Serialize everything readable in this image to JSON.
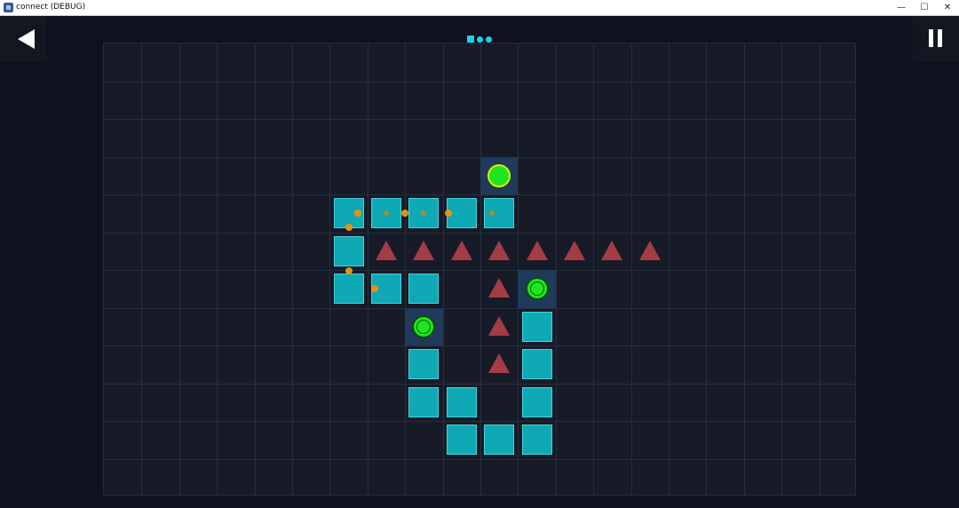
{
  "window": {
    "title": "connect (DEBUG)",
    "minimize_glyph": "—",
    "maximize_glyph": "☐",
    "close_glyph": "✕"
  },
  "toolbar": {
    "back_icon": "back-arrow-icon",
    "pause_icon": "pause-icon"
  },
  "level_progress": {
    "indicators": [
      "square",
      "circle",
      "circle"
    ],
    "color": "#1ccfe6"
  },
  "board": {
    "cols": 20,
    "rows": 12,
    "colors": {
      "background": "#161b27",
      "tile": "#0fa8b5",
      "hazard": "#a43c46",
      "target": "#1ee61e",
      "orb": "#e8920f"
    },
    "tiles": [
      [
        6,
        4
      ],
      [
        7,
        4
      ],
      [
        8,
        4
      ],
      [
        9,
        4
      ],
      [
        10,
        4
      ],
      [
        6,
        5
      ],
      [
        6,
        6
      ],
      [
        7,
        6
      ],
      [
        8,
        6
      ],
      [
        8,
        8
      ],
      [
        11,
        7
      ],
      [
        11,
        8
      ],
      [
        8,
        9
      ],
      [
        9,
        9
      ],
      [
        11,
        9
      ],
      [
        9,
        10
      ],
      [
        10,
        10
      ],
      [
        11,
        10
      ]
    ],
    "targets": [
      {
        "col": 10,
        "row": 3,
        "ring": "yellow"
      },
      {
        "col": 11,
        "row": 6,
        "ring": "dark"
      },
      {
        "col": 8,
        "row": 7,
        "ring": "dark"
      }
    ],
    "hazards": [
      [
        7,
        5
      ],
      [
        8,
        5
      ],
      [
        9,
        5
      ],
      [
        10,
        5
      ],
      [
        11,
        5
      ],
      [
        12,
        5
      ],
      [
        13,
        5
      ],
      [
        14,
        5
      ],
      [
        10,
        6
      ],
      [
        10,
        7
      ],
      [
        10,
        8
      ]
    ],
    "orbs": [
      {
        "x": 6.75,
        "y": 4.5,
        "kind": "bright"
      },
      {
        "x": 7.5,
        "y": 4.5,
        "kind": "dim"
      },
      {
        "x": 8.0,
        "y": 4.5,
        "kind": "bright"
      },
      {
        "x": 8.5,
        "y": 4.5,
        "kind": "dim"
      },
      {
        "x": 9.15,
        "y": 4.5,
        "kind": "bright"
      },
      {
        "x": 10.3,
        "y": 4.5,
        "kind": "dim"
      },
      {
        "x": 6.5,
        "y": 4.87,
        "kind": "bright"
      },
      {
        "x": 6.5,
        "y": 6.03,
        "kind": "bright"
      },
      {
        "x": 7.2,
        "y": 6.5,
        "kind": "bright"
      }
    ]
  }
}
